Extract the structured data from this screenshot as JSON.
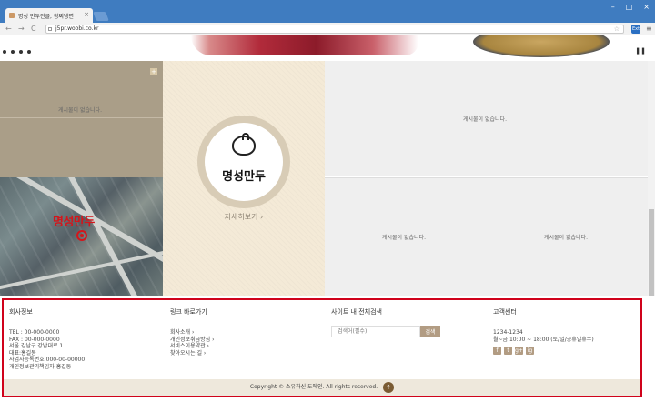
{
  "browser": {
    "tab_title": "명성 만두전골, 칭찌냉면",
    "tab_close": "×",
    "url": "j5pr.woobi.co.kr",
    "back": "←",
    "forward": "→",
    "reload": "C",
    "window_buttons": [
      "–",
      "□",
      "×"
    ],
    "extension_label": "Ext"
  },
  "banner": {
    "slide_count": 4,
    "pause_label": "❚❚"
  },
  "panels": {
    "no_post": "게시물이 없습니다.",
    "plus_label": "+",
    "map_label": "명성만두",
    "logo_text": "명성만두",
    "detail_link": "자세히보기 ›"
  },
  "footer": {
    "company": {
      "heading": "회사정보",
      "lines": [
        "TEL : 00-000-0000",
        "FAX : 00-000-0000",
        "서울 강남구 강남대로 1",
        "대표:홍길동",
        "사업자등록번호:000-00-00000",
        "개인정보관리책임자:홍길동"
      ]
    },
    "links": {
      "heading": "링크 바로가기",
      "items": [
        "회사소개 ›",
        "개인정보취급방침 ›",
        "서비스이용약관 ›",
        "찾아오시는 길 ›"
      ]
    },
    "search": {
      "heading": "사이트 내 전체검색",
      "placeholder": "검색어(필수)",
      "button": "검색"
    },
    "cs": {
      "heading": "고객센터",
      "phone": "1234-1234",
      "hours": "월~금 10:00 ~ 18:00 (토/일/공휴일휴무)",
      "social": [
        "f",
        "t",
        "g+",
        "ig"
      ]
    },
    "copyright": "Copyright © 소유하신 도메인. All rights reserved.",
    "top_label": "↑"
  }
}
